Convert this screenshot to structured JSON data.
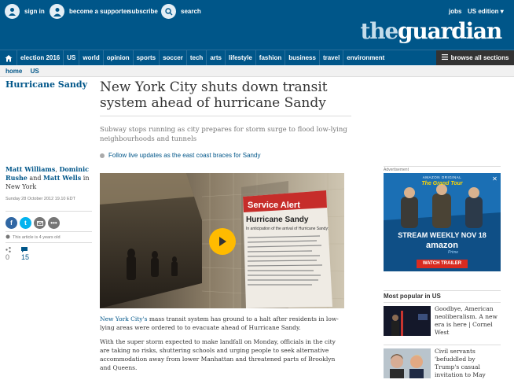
{
  "header": {
    "sign_in": "sign in",
    "become_supporter": "become a supporter",
    "subscribe": "subscribe",
    "search": "search",
    "jobs": "jobs",
    "edition": "US edition",
    "logo_the": "the",
    "logo_guardian": "guardian"
  },
  "nav": {
    "items": [
      "election 2016",
      "US",
      "world",
      "opinion",
      "sports",
      "soccer",
      "tech",
      "arts",
      "lifestyle",
      "fashion",
      "business",
      "travel",
      "environment"
    ],
    "browse": "browse all sections"
  },
  "breadcrumb": [
    "home",
    "US"
  ],
  "article": {
    "section": "Hurricane Sandy",
    "headline": "New York City shuts down transit system ahead of hurricane Sandy",
    "standfirst": "Subway stops running as city prepares for storm surge to flood low-lying neighbourhoods and tunnels",
    "live_link": "Follow live updates as the east coast braces for Sandy",
    "byline": {
      "author1": "Matt Williams",
      "sep1": ", ",
      "author2": "Dominic Rushe",
      "and": " and ",
      "author3": "Matt Wells",
      "location": " in New York"
    },
    "dateline": "Sunday 28 October 2012 19.10 EDT",
    "age_notice": "This article is 4 years old",
    "shares": "0",
    "comments": "15",
    "photo_sign_title": "Service Alert",
    "photo_sign_sub": "Hurricane Sandy",
    "photo_sign_text": "In anticipation of the arrival of Hurricane Sandy:",
    "body": {
      "p1_link": "New York City's",
      "p1_rest": " mass transit system has ground to a halt after residents in low-lying areas were ordered to to evacuate ahead of Hurricane Sandy.",
      "p2": "With the super storm expected to make landfall on Monday, officials in the city are taking no risks, shuttering schools and urging people to seek alternative accommodation away from lower Manhattan and threatened parts of Brooklyn and Queens."
    }
  },
  "ad": {
    "label": "Advertisement",
    "top": "AMAZON ORIGINAL",
    "show": "The Grand Tour",
    "stream": "STREAM WEEKLY NOV 18",
    "amazon": "amazon",
    "prime": "Prime",
    "watch": "WATCH TRAILER"
  },
  "most_popular": {
    "title": "Most popular in US",
    "items": [
      {
        "text": "Goodbye, American neoliberalism. A new era is here | Cornel West"
      },
      {
        "text": "Civil servants 'befuddled by Trump's casual invitation to May"
      }
    ]
  },
  "colors": {
    "brand": "#005689",
    "play": "#ffbb00",
    "ad_bg": "#1b6fb4"
  }
}
